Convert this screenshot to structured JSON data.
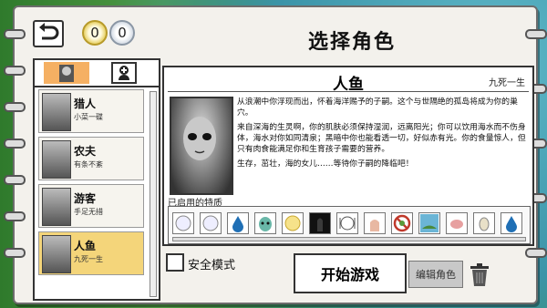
{
  "header": {
    "title": "选择角色",
    "gold_count": "0",
    "silver_count": "0"
  },
  "characters": [
    {
      "name": "猎人",
      "subtitle": "小菜一碟"
    },
    {
      "name": "农夫",
      "subtitle": "有条不紊"
    },
    {
      "name": "游客",
      "subtitle": "手足无措"
    },
    {
      "name": "人鱼",
      "subtitle": "九死一生"
    }
  ],
  "selected": {
    "name": "人鱼",
    "difficulty": "九死一生",
    "description": [
      "从浪潮中你浮现而出，怀着海洋赐予的子嗣。这个与世隔绝的孤岛将成为你的巢穴。",
      "来自深海的生灵啊，你的肌肤必须保持湿润，远离阳光；你可以饮用海水而不伤身体，海水对你如同清泉；黑暗中你也能看透一切，好似赤有光。你的食量惊人，但只有肉食能满足你和生育孩子需要的营养。",
      "生存，茁壮，海的女儿……等待你子嗣的降临吧！"
    ]
  },
  "traits": {
    "label": "已启用的特质",
    "icons": [
      "moon-icon",
      "moon-icon",
      "water-drop-icon",
      "mermaid-face-icon",
      "sun-icon",
      "dark-figure-icon",
      "plate-icon",
      "body-icon",
      "no-vegetables-icon",
      "island-icon",
      "meat-icon",
      "egg-icon",
      "water-drop-icon"
    ]
  },
  "footer": {
    "safe_mode": "安全模式",
    "start": "开始游戏",
    "edit": "编辑角色"
  }
}
